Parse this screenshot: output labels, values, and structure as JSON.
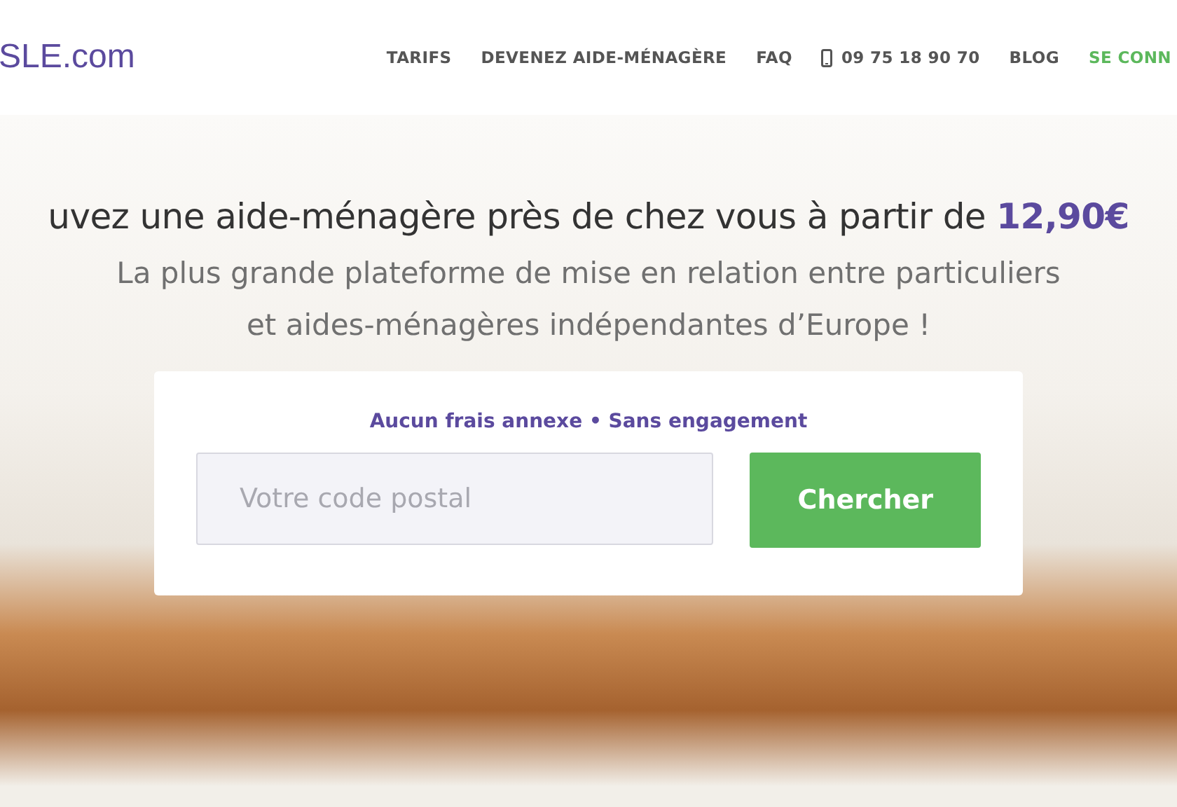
{
  "header": {
    "logo": "SLE.com",
    "nav": [
      {
        "kind": "link",
        "label": "TARIFS"
      },
      {
        "kind": "link",
        "label": "DEVENEZ AIDE-MÉNAGÈRE"
      },
      {
        "kind": "link",
        "label": "FAQ"
      },
      {
        "kind": "phone",
        "label": "09 75 18 90 70"
      },
      {
        "kind": "link",
        "label": "BLOG"
      },
      {
        "kind": "login",
        "label": "SE CONN"
      }
    ]
  },
  "hero": {
    "headline": "uvez une aide-ménagère près de chez vous à partir de **12,90€**",
    "subtitle_lines": [
      "La plus grande plateforme de mise en relation entre particuliers",
      "et aides-ménagères indépendantes d’Europe !"
    ],
    "search_card": {
      "tagline": "Aucun frais annexe • Sans engagement",
      "postcode": {
        "placeholder": "Votre code postal"
      },
      "button": "Chercher"
    }
  }
}
